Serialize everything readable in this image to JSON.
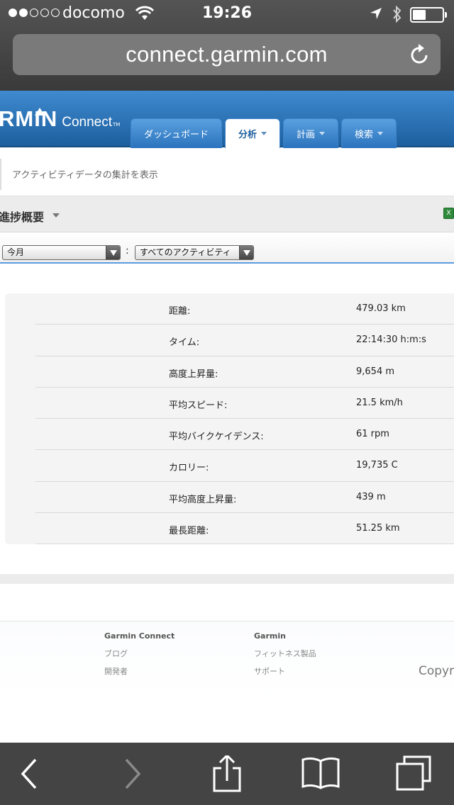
{
  "statusbar": {
    "carrier": "docomo",
    "time": "19:26",
    "signal_bars": 2,
    "signal_total": 5,
    "battery_level": 0.45
  },
  "browser": {
    "url": "connect.garmin.com"
  },
  "header": {
    "logo_mark": "RMIN",
    "logo_sub": "Connect",
    "logo_tm": "TM",
    "tabs": [
      {
        "label": "ダッシュボード",
        "has_menu": false,
        "active": false
      },
      {
        "label": "分析",
        "has_menu": true,
        "active": true
      },
      {
        "label": "計画",
        "has_menu": true,
        "active": false
      },
      {
        "label": "検索",
        "has_menu": true,
        "active": false
      }
    ]
  },
  "page": {
    "subtitle": "アクティビティデータの集計を表示",
    "section_title": "進捗概要",
    "filters": {
      "period": "今月",
      "activity": "すべてのアクティビティ",
      "separator": ":"
    },
    "stats": [
      {
        "label": "距離:",
        "value": "479.03 km"
      },
      {
        "label": "タイム:",
        "value": "22:14:30 h:m:s"
      },
      {
        "label": "高度上昇量:",
        "value": "9,654 m"
      },
      {
        "label": "平均スピード:",
        "value": "21.5 km/h"
      },
      {
        "label": "平均バイクケイデンス:",
        "value": "61 rpm"
      },
      {
        "label": "カロリー:",
        "value": "19,735 C"
      },
      {
        "label": "平均高度上昇量:",
        "value": "439 m"
      },
      {
        "label": "最長距離:",
        "value": "51.25 km"
      }
    ]
  },
  "footer": {
    "col1": {
      "head": "Garmin Connect",
      "links": [
        "ブログ",
        "開発者"
      ]
    },
    "col2": {
      "head": "Garmin",
      "links": [
        "フィットネス製品",
        "サポート"
      ]
    },
    "copyright": "Copyr"
  },
  "colors": {
    "header_blue": "#2a73bd",
    "toolbar": "#444444"
  }
}
